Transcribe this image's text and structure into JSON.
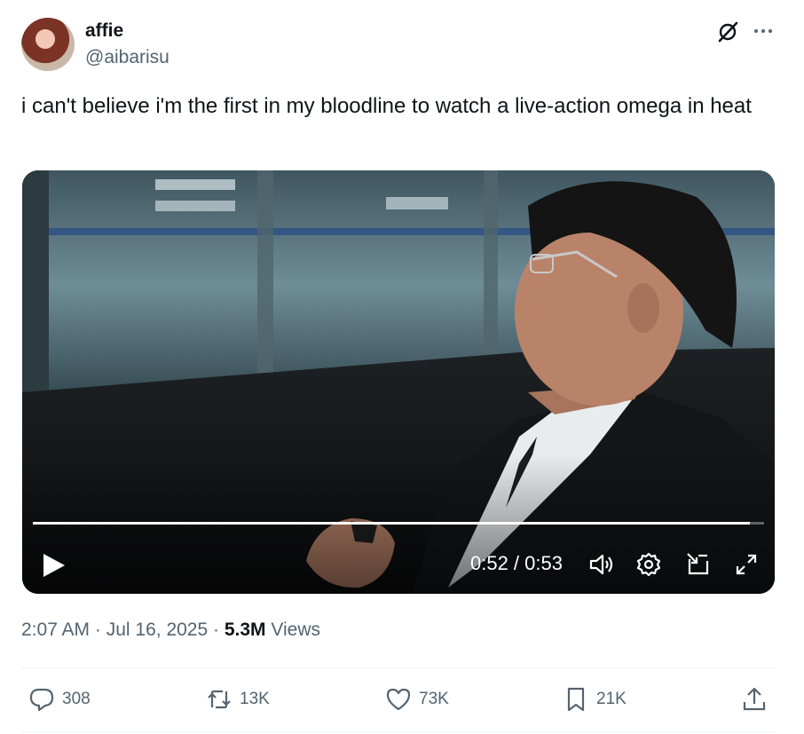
{
  "author": {
    "display_name": "affie",
    "handle": "@aibarisu"
  },
  "tweet": {
    "text": "i can't believe i'm the first in my bloodline to watch a live-action omega in heat"
  },
  "video": {
    "time_display": "0:52 / 0:53",
    "progress_fraction": 0.98
  },
  "meta": {
    "time": "2:07 AM",
    "date": "Jul 16, 2025",
    "views_count": "5.3M",
    "views_label": "Views"
  },
  "actions": {
    "replies": "308",
    "reposts": "13K",
    "likes": "73K",
    "bookmarks": "21K"
  },
  "icons": [
    "grok-icon",
    "more-icon",
    "play-icon",
    "volume-icon",
    "settings-icon",
    "dock-icon",
    "fullscreen-icon",
    "reply-icon",
    "repost-icon",
    "like-icon",
    "bookmark-icon",
    "share-icon"
  ]
}
